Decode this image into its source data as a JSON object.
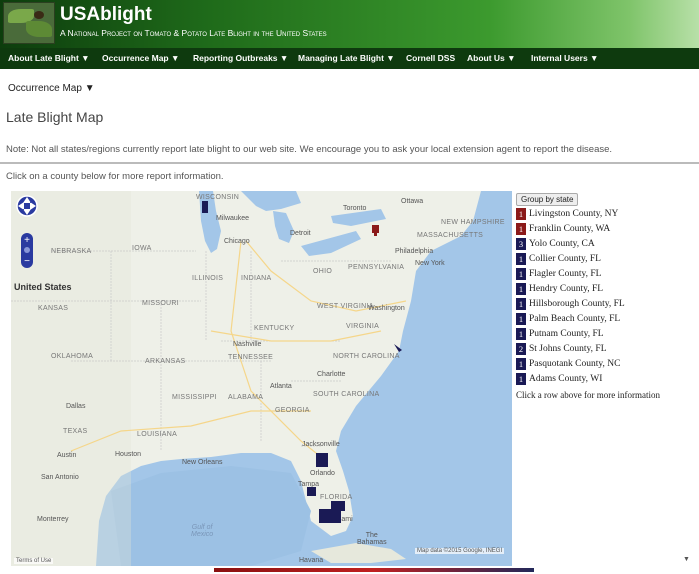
{
  "header": {
    "site_title": "USAblight",
    "subtitle": "A National Project on Tomato & Potato Late Blight in the United States"
  },
  "nav": {
    "items": [
      {
        "label": "About Late Blight ▼"
      },
      {
        "label": "Occurrence Map ▼"
      },
      {
        "label": "Reporting Outbreaks ▼"
      },
      {
        "label": "Managing Late Blight ▼"
      },
      {
        "label": "Cornell DSS"
      },
      {
        "label": "About Us ▼"
      },
      {
        "label": "Internal Users ▼"
      }
    ]
  },
  "submenu": {
    "label": "Occurrence Map ▼"
  },
  "page": {
    "title": "Late Blight Map",
    "note": "Note: Not all states/regions currently report late blight to our web site. We encourage you to ask your local extension agent to report the disease.",
    "instruction": "Click on a county below for more report information."
  },
  "map": {
    "attribution": "Map data ©2015 Google, INEGI",
    "terms": "Terms of Use",
    "labels": {
      "wisconsin": "WISCONSIN",
      "milwaukee": "Milwaukee",
      "chicago": "Chicago",
      "detroit": "Detroit",
      "toronto": "Toronto",
      "ottawa": "Ottawa",
      "new_hampshire": "NEW HAMPSHIRE",
      "massachusetts": "MASSACHUSETTS",
      "new_york": "New York",
      "pennsylvania": "PENNSYLVANIA",
      "philadelphia": "Philadelphia",
      "ohio": "OHIO",
      "indiana": "INDIANA",
      "illinois": "ILLINOIS",
      "iowa": "IOWA",
      "nebraska": "NEBRASKA",
      "united_states": "United States",
      "kansas": "KANSAS",
      "missouri": "MISSOURI",
      "kentucky": "KENTUCKY",
      "west_virginia": "WEST VIRGINIA",
      "virginia": "VIRGINIA",
      "washington": "Washington",
      "nashville": "Nashville",
      "tennessee": "TENNESSEE",
      "north_carolina": "NORTH CAROLINA",
      "oklahoma": "OKLAHOMA",
      "arkansas": "ARKANSAS",
      "charlotte": "Charlotte",
      "south_carolina": "SOUTH CAROLINA",
      "atlanta": "Atlanta",
      "mississippi": "MISSISSIPPI",
      "alabama": "ALABAMA",
      "georgia": "GEORGIA",
      "dallas": "Dallas",
      "texas": "TEXAS",
      "louisiana": "LOUISIANA",
      "jacksonville": "Jacksonville",
      "austin": "Austin",
      "houston": "Houston",
      "new_orleans": "New Orleans",
      "orlando": "Orlando",
      "tampa": "Tampa",
      "san_antonio": "San Antonio",
      "florida": "FLORIDA",
      "miami": "Miami",
      "monterrey": "Monterrey",
      "gulf_of_mexico": "Gulf of\nMexico",
      "the_bahamas": "The\nBahamas",
      "havana": "Havana"
    }
  },
  "panel": {
    "group_button": "Group by state",
    "hint": "Click a row above for more information",
    "reports": [
      {
        "count": "1",
        "county": "Livingston County, NY",
        "color": "#8b1a1a"
      },
      {
        "count": "1",
        "county": "Franklin County, WA",
        "color": "#8b1a1a"
      },
      {
        "count": "3",
        "county": "Yolo County, CA",
        "color": "#1a1a55"
      },
      {
        "count": "1",
        "county": "Collier County, FL",
        "color": "#1a1a55"
      },
      {
        "count": "1",
        "county": "Flagler County, FL",
        "color": "#1a1a55"
      },
      {
        "count": "1",
        "county": "Hendry County, FL",
        "color": "#1a1a55"
      },
      {
        "count": "1",
        "county": "Hillsborough County, FL",
        "color": "#1a1a55"
      },
      {
        "count": "1",
        "county": "Palm Beach County, FL",
        "color": "#1a1a55"
      },
      {
        "count": "1",
        "county": "Putnam County, FL",
        "color": "#1a1a55"
      },
      {
        "count": "2",
        "county": "St Johns County, FL",
        "color": "#1a1a55"
      },
      {
        "count": "1",
        "county": "Pasquotank County, NC",
        "color": "#1a1a55"
      },
      {
        "count": "1",
        "county": "Adams County, WI",
        "color": "#1a1a55"
      }
    ]
  },
  "colors": {
    "header_green": "#1f6b1a",
    "nav_dark": "#0e3a0e",
    "report_red": "#8b1a1a",
    "report_navy": "#1a1a55",
    "water": "#a3c6e8"
  }
}
